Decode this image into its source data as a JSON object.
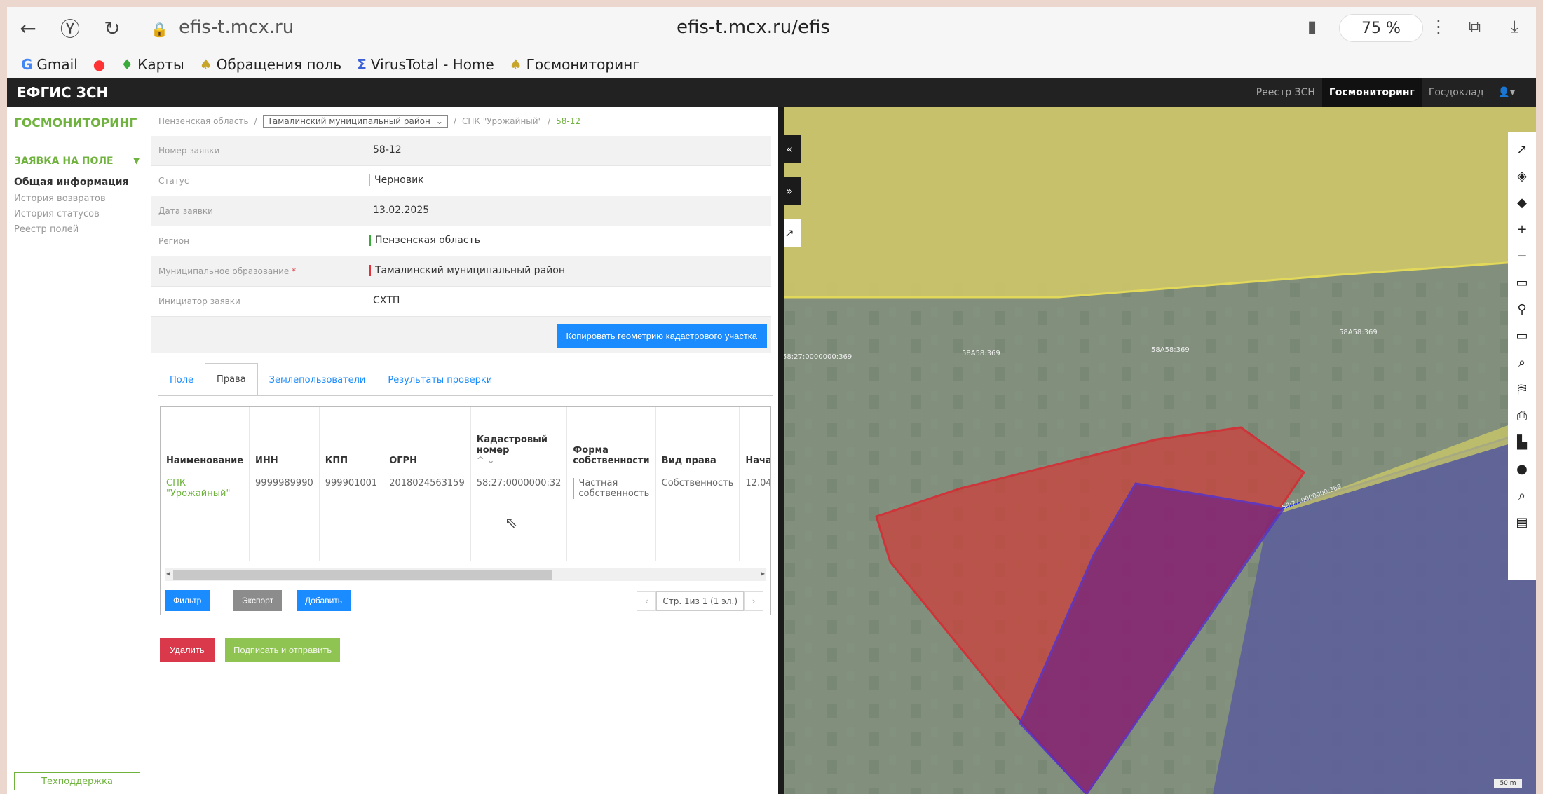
{
  "browser": {
    "domain": "efis-t.mcx.ru",
    "url": "efis-t.mcx.ru/efis",
    "zoom": "75 %",
    "bookmarks": [
      "Gmail",
      "Карты",
      "Обращения поль",
      "VirusTotal - Home",
      "Госмониторинг"
    ]
  },
  "app": {
    "logo": "ЕФГИС ЗСН",
    "menu": [
      "Реестр ЗСН",
      "Госмониторинг",
      "Госдоклад"
    ]
  },
  "sidebar": {
    "title": "ГОСМОНИТОРИНГ",
    "section": "ЗАЯВКА НА ПОЛЕ",
    "items": [
      "Общая информация",
      "История возвратов",
      "История статусов",
      "Реестр полей"
    ],
    "support": "Техподдержка"
  },
  "breadcrumb": {
    "region": "Пензенская область",
    "district": "Тамалинский муниципальный район",
    "org": "СПК \"Урожайный\"",
    "number": "58-12"
  },
  "form": [
    {
      "label": "Номер заявки",
      "value": "58-12"
    },
    {
      "label": "Статус",
      "value": "Черновик"
    },
    {
      "label": "Дата заявки",
      "value": "13.02.2025"
    },
    {
      "label": "Регион",
      "value": "Пензенская область"
    },
    {
      "label": "Муниципальное образование",
      "value": "Тамалинский муниципальный район"
    },
    {
      "label": "Инициатор заявки",
      "value": "СХТП"
    }
  ],
  "copy_button": "Копировать геометрию кадастрового участка",
  "tabs": [
    "Поле",
    "Права",
    "Землепользователи",
    "Результаты проверки"
  ],
  "table": {
    "headers": [
      "Наименование",
      "ИНН",
      "КПП",
      "ОГРН",
      "Кадастровый номер",
      "Форма собственности",
      "Вид права",
      "Нача"
    ],
    "row": [
      "СПК \"Урожайный\"",
      "9999989990",
      "999901001",
      "2018024563159",
      "58:27:0000000:32",
      "Частная собственность",
      "Собственность",
      "12.04"
    ]
  },
  "table_buttons": {
    "filter": "Фильтр",
    "export": "Экспорт",
    "add": "Добавить"
  },
  "pager": "Стр. 1из 1 (1 эл.)",
  "actions": {
    "delete": "Удалить",
    "sign": "Подписать и отправить"
  },
  "map": {
    "labels": [
      "58:27:0000000:369",
      "58А58:369",
      "58А58:369",
      "58А58:369",
      "58:27:0000000:369"
    ],
    "scale": "50 m"
  }
}
